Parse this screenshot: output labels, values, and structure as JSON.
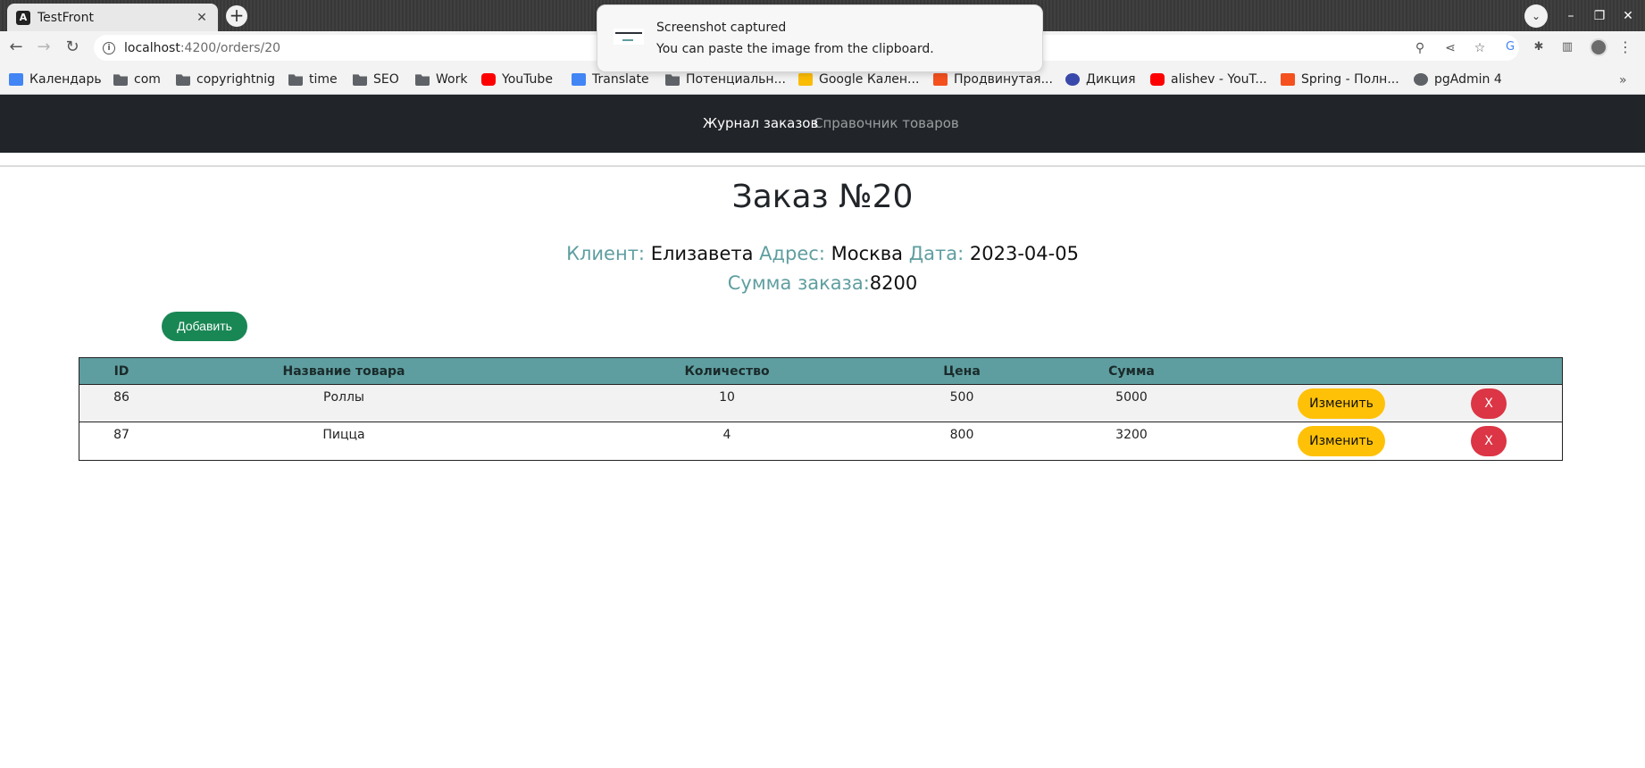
{
  "browser": {
    "tab_title": "TestFront",
    "tab_favicon": "A",
    "url_host": "localhost",
    "url_path": ":4200/orders/20",
    "bookmarks": [
      {
        "label": "Календарь",
        "icon": "calendar-icon",
        "color": "#4285f4"
      },
      {
        "label": "com",
        "icon": "folder-icon",
        "color": "#5f6368"
      },
      {
        "label": "copyrightnig",
        "icon": "folder-icon",
        "color": "#5f6368"
      },
      {
        "label": "time",
        "icon": "folder-icon",
        "color": "#5f6368"
      },
      {
        "label": "SEO",
        "icon": "folder-icon",
        "color": "#5f6368"
      },
      {
        "label": "Work",
        "icon": "folder-icon",
        "color": "#5f6368"
      },
      {
        "label": "YouTube",
        "icon": "youtube-icon",
        "color": "#ff0000"
      },
      {
        "label": "Translate",
        "icon": "translate-icon",
        "color": "#4285f4"
      },
      {
        "label": "Потенциальн...",
        "icon": "folder-icon",
        "color": "#5f6368"
      },
      {
        "label": "Google Кален...",
        "icon": "calendar-icon",
        "color": "#fbbc04"
      },
      {
        "label": "Продвинутая...",
        "icon": "stepik-icon",
        "color": "#f4511e"
      },
      {
        "label": "Дикция",
        "icon": "dikcia-icon",
        "color": "#3949ab"
      },
      {
        "label": "alishev - YouT...",
        "icon": "youtube-icon",
        "color": "#ff0000"
      },
      {
        "label": "Spring - Полн...",
        "icon": "stepik-icon",
        "color": "#f4511e"
      },
      {
        "label": "pgAdmin 4",
        "icon": "globe-icon",
        "color": "#5f6368"
      }
    ]
  },
  "notification": {
    "title": "Screenshot captured",
    "body": "You can paste the image from the clipboard."
  },
  "nav": {
    "orders_link": "Журнал заказов",
    "products_link": "Справочник товаров"
  },
  "order": {
    "title": "Заказ №20",
    "client_label": "Клиент:",
    "client_value": "Елизавета",
    "address_label": "Адрес:",
    "address_value": "Москва",
    "date_label": "Дата:",
    "date_value": "2023-04-05",
    "total_label": "Сумма заказа:",
    "total_value": "8200"
  },
  "add_button": "Добавить",
  "table": {
    "headers": {
      "id": "ID",
      "name": "Название товара",
      "qty": "Количество",
      "price": "Цена",
      "sum": "Сумма"
    },
    "rows": [
      {
        "id": "86",
        "name": "Роллы",
        "qty": "10",
        "price": "500",
        "sum": "5000",
        "edit": "Изменить",
        "delete": "X"
      },
      {
        "id": "87",
        "name": "Пицца",
        "qty": "4",
        "price": "800",
        "sum": "3200",
        "edit": "Изменить",
        "delete": "X"
      }
    ]
  },
  "colors": {
    "navbar": "#212529",
    "label_accent": "#5f9ea0",
    "add_button": "#198754",
    "edit_button": "#ffc107",
    "delete_button": "#dc3545"
  }
}
